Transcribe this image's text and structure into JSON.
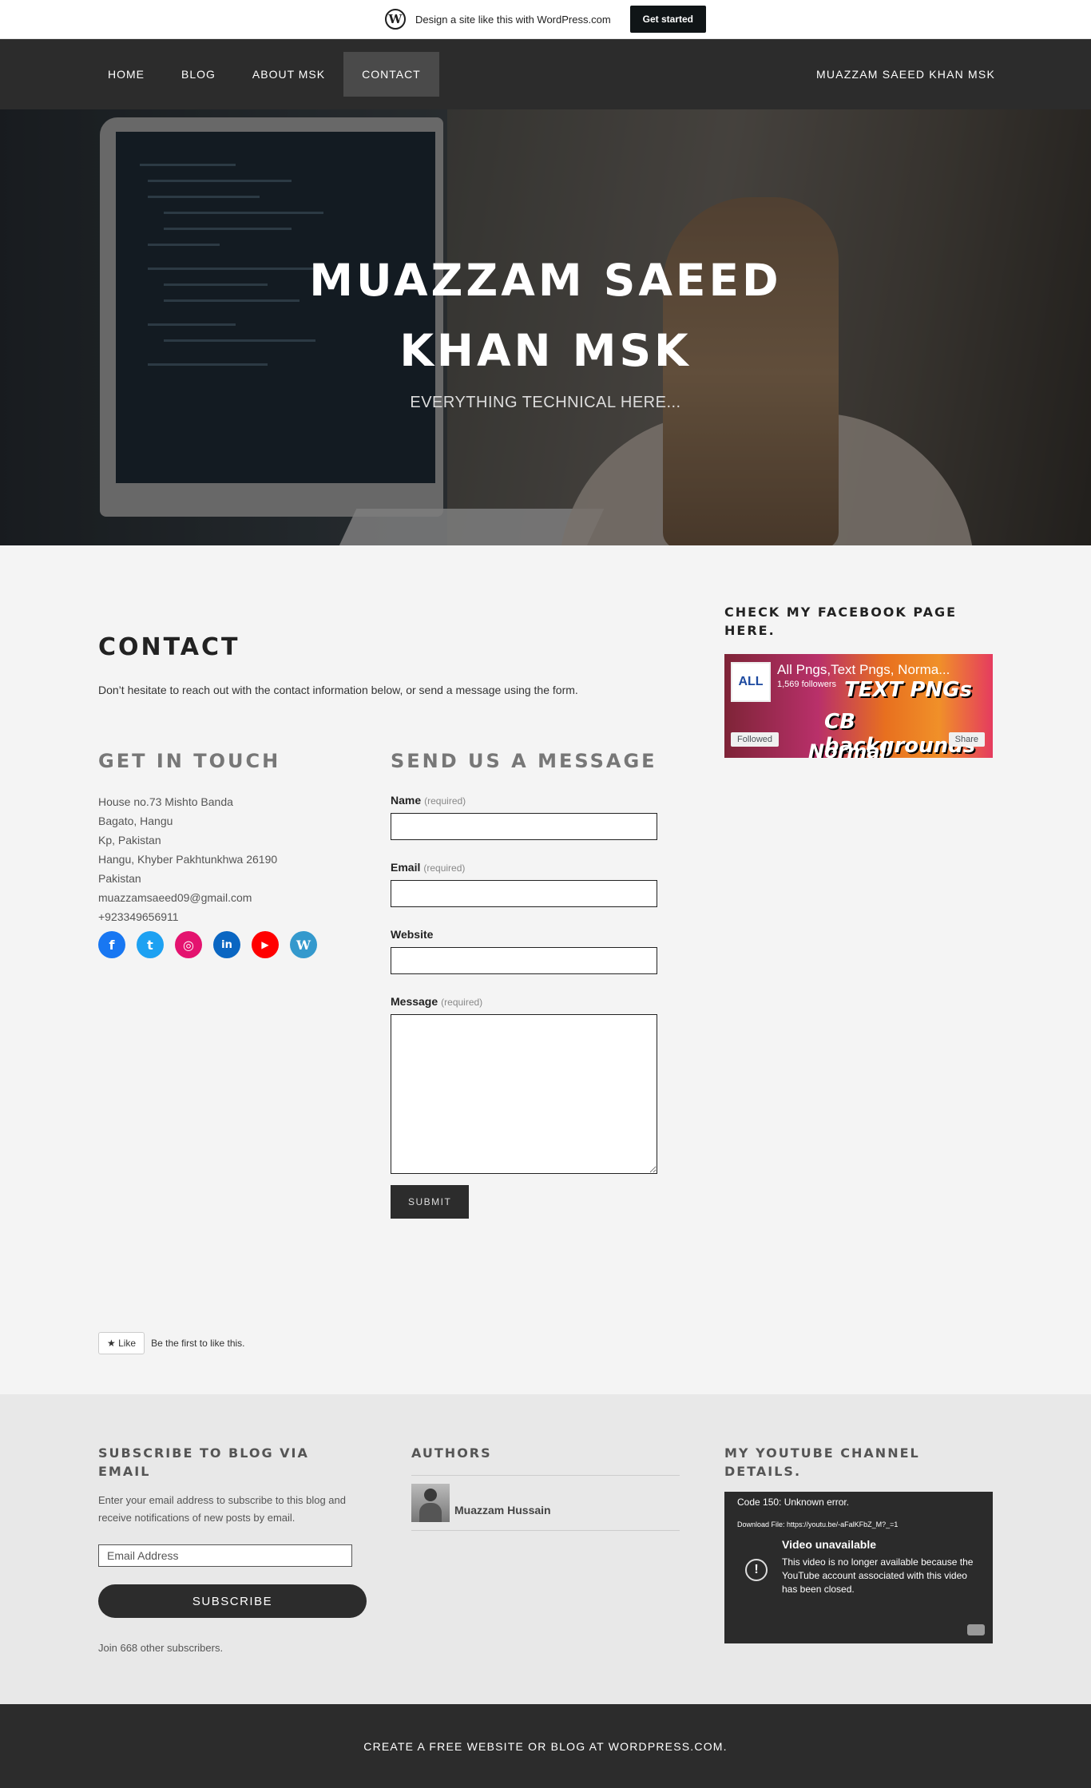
{
  "promo": {
    "text": "Design a site like this with WordPress.com",
    "button": "Get started",
    "logo_letter": "W"
  },
  "nav": {
    "items": [
      {
        "label": "HOME"
      },
      {
        "label": "BLOG"
      },
      {
        "label": "ABOUT MSK"
      },
      {
        "label": "CONTACT",
        "active": true
      }
    ],
    "site_name": "MUAZZAM SAEED KHAN MSK"
  },
  "hero": {
    "title": "MUAZZAM SAEED KHAN MSK",
    "tagline": "EVERYTHING TECHNICAL HERE..."
  },
  "page": {
    "title": "CONTACT",
    "intro": "Don’t hesitate to reach out with the contact information below, or send a message using the form."
  },
  "get_in_touch": {
    "heading": "GET IN TOUCH",
    "address_lines": [
      "House no.73 Mishto Banda",
      "Bagato, Hangu",
      "Kp, Pakistan",
      "Hangu, Khyber Pakhtunkhwa 26190",
      "Pakistan"
    ],
    "email": "muazzamsaeed09@gmail.com",
    "phone": "+923349656911",
    "social": [
      {
        "name": "facebook-icon",
        "glyph": "f",
        "color": "#1877f2"
      },
      {
        "name": "twitter-icon",
        "glyph": "t",
        "color": "#1da1f2"
      },
      {
        "name": "instagram-icon",
        "glyph": "◎",
        "color": "#e4136f"
      },
      {
        "name": "linkedin-icon",
        "glyph": "in",
        "color": "#0a66c2"
      },
      {
        "name": "youtube-icon",
        "glyph": "▶",
        "color": "#ff0000"
      },
      {
        "name": "wordpress-icon",
        "glyph": "W",
        "color": "#3499cd"
      }
    ]
  },
  "form": {
    "heading": "SEND US A MESSAGE",
    "name_label": "Name",
    "email_label": "Email",
    "website_label": "Website",
    "message_label": "Message",
    "required": "(required)",
    "submit": "SUBMIT"
  },
  "like": {
    "button": "★ Like",
    "text": "Be the first to like this."
  },
  "sidebar": {
    "heading": "CHECK MY FACEBOOK PAGE HERE.",
    "fb_page_name": "All Pngs,Text Pngs, Norma...",
    "fb_followers": "1,569 followers",
    "fb_followed": "Followed",
    "fb_share": "Share",
    "fb_thumb_text": "ALL",
    "fb_banner_1": "TEXT PNGs",
    "fb_banner_2": "CB backgrounds",
    "fb_banner_3": "Normal Backgrounds"
  },
  "subscribe": {
    "heading": "SUBSCRIBE TO BLOG VIA EMAIL",
    "text": "Enter your email address to subscribe to this blog and receive notifications of new posts by email.",
    "placeholder": "Email Address",
    "button": "SUBSCRIBE",
    "count_text": "Join 668 other subscribers."
  },
  "authors": {
    "heading": "AUTHORS",
    "name": "Muazzam Hussain"
  },
  "youtube": {
    "heading": "MY YOUTUBE CHANNEL DETAILS.",
    "error": "Code 150: Unknown error.",
    "download": "Download File: https://youtu.be/-aFalKFbZ_M?_=1",
    "title": "Video unavailable",
    "message": "This video is no longer available because the YouTube account associated with this video has been closed."
  },
  "footer": {
    "text": "CREATE A FREE WEBSITE OR BLOG AT WORDPRESS.COM."
  }
}
